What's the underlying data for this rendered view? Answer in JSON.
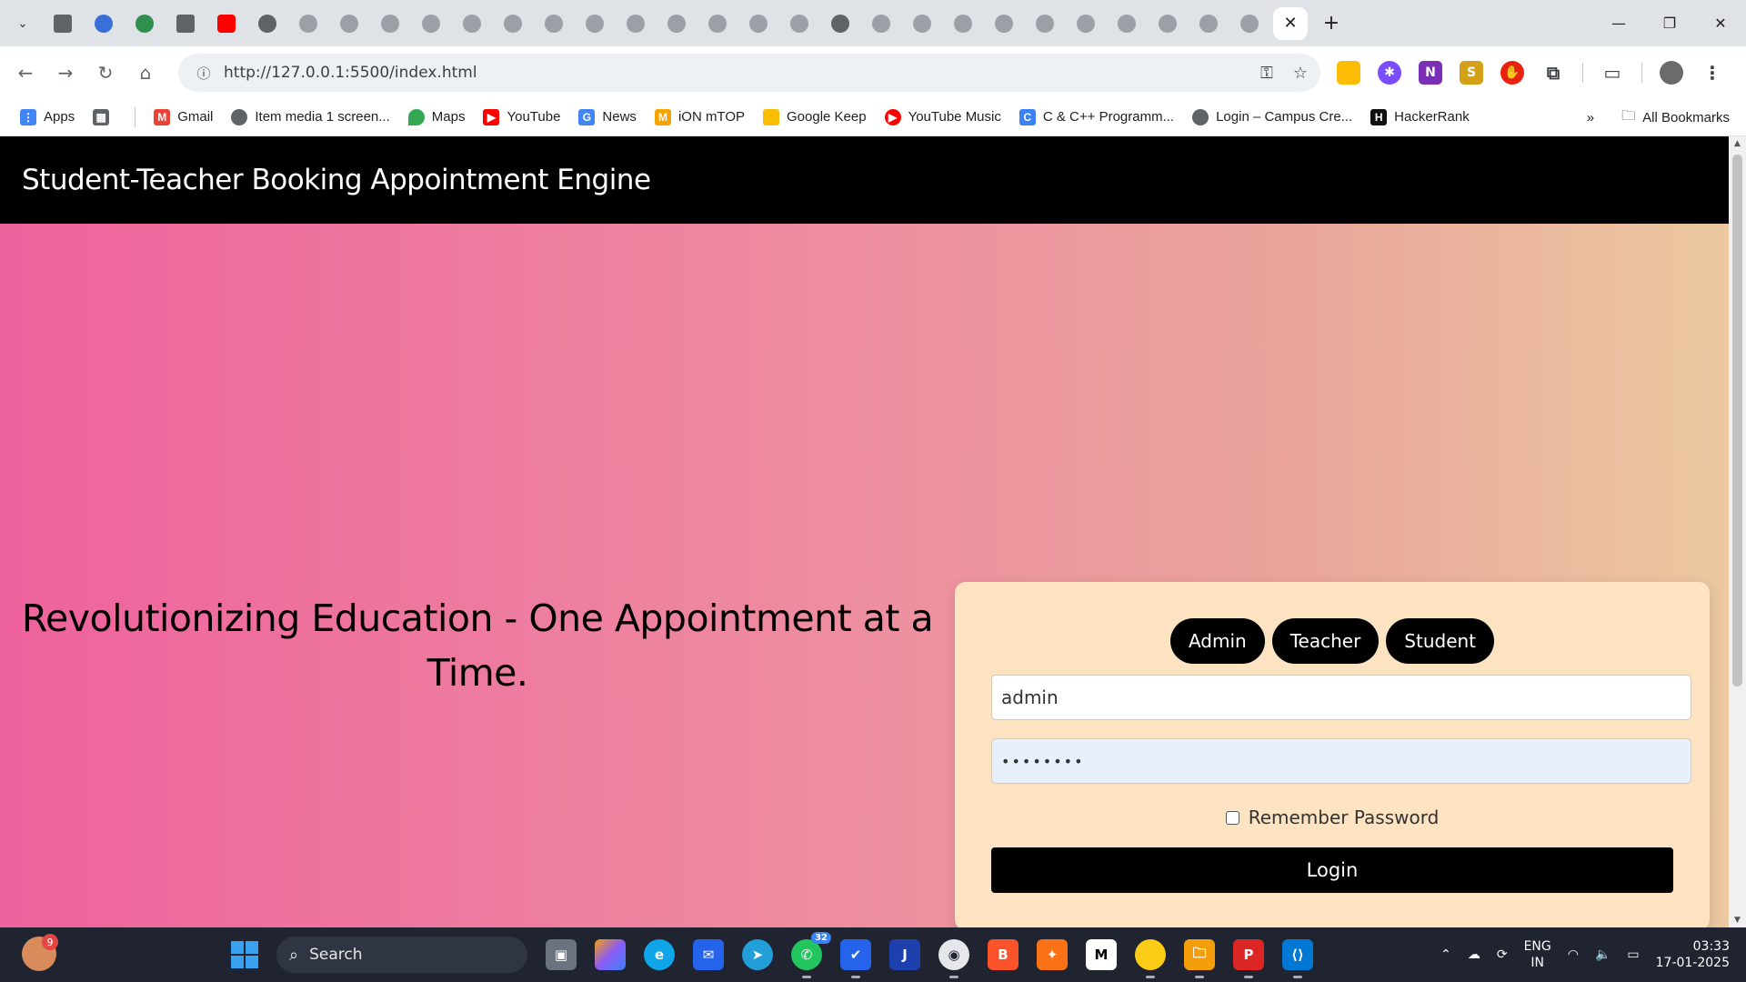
{
  "browser": {
    "active_tab_close": "✕",
    "new_tab": "+",
    "url": "http://127.0.0.1:5500/index.html",
    "window_controls": [
      "—",
      "❐",
      "✕"
    ]
  },
  "bookmarks": {
    "items": [
      {
        "label": "Apps",
        "icon": "apps-grid-icon",
        "color": "#4285f4"
      },
      {
        "label": "",
        "icon": "tab-groups-icon",
        "color": "#5f6368"
      },
      {
        "label": "Gmail",
        "icon": "gmail-icon",
        "color": "#ea4335"
      },
      {
        "label": "Item media 1 screen...",
        "icon": "globe-icon",
        "color": "#5f6368"
      },
      {
        "label": "Maps",
        "icon": "maps-pin-icon",
        "color": "#34a853"
      },
      {
        "label": "YouTube",
        "icon": "youtube-icon",
        "color": "#ff0000"
      },
      {
        "label": "News",
        "icon": "news-icon",
        "color": "#4285f4"
      },
      {
        "label": "iON mTOP",
        "icon": "ion-icon",
        "color": "#f4a300"
      },
      {
        "label": "Google Keep",
        "icon": "keep-icon",
        "color": "#fbbc04"
      },
      {
        "label": "YouTube Music",
        "icon": "youtube-music-icon",
        "color": "#ff0000"
      },
      {
        "label": "C & C++ Programm...",
        "icon": "cpp-icon",
        "color": "#3b82f6"
      },
      {
        "label": "Login – Campus Cre...",
        "icon": "globe-icon",
        "color": "#5f6368"
      },
      {
        "label": "HackerRank",
        "icon": "hackerrank-icon",
        "color": "#111111"
      }
    ],
    "overflow": "»",
    "all_bookmarks": "All Bookmarks"
  },
  "page": {
    "header_title": "Student-Teacher Booking Appointment Engine",
    "tagline": "Revolutionizing Education - One Appointment at a Time.",
    "roles": [
      "Admin",
      "Teacher",
      "Student"
    ],
    "username_value": "admin",
    "password_value": "••••••••",
    "remember_label": "Remember Password",
    "login_label": "Login"
  },
  "taskbar": {
    "weather_badge": "9",
    "search_label": "Search",
    "whatsapp_count": "32",
    "lang_line1": "ENG",
    "lang_line2": "IN",
    "time": "03:33",
    "date": "17-01-2025"
  },
  "colors": {
    "header_bg": "#000000",
    "card_bg": "#fde3c2",
    "gradient_start": "#ee629d",
    "gradient_end": "#ebc8a0",
    "button_bg": "#000000"
  }
}
